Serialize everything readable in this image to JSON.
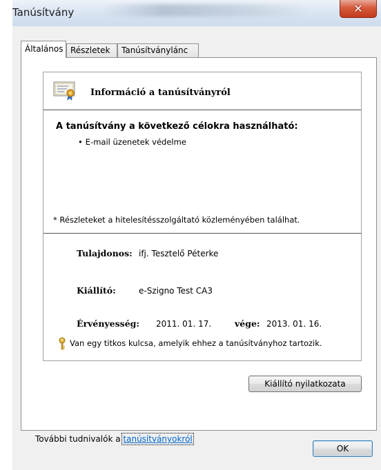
{
  "window": {
    "title": "Tanúsítvány",
    "close_glyph": "✕"
  },
  "tabs": [
    {
      "label": "Általános",
      "active": true
    },
    {
      "label": "Részletek",
      "active": false
    },
    {
      "label": "Tanúsítványlánc",
      "active": false
    }
  ],
  "general": {
    "info_title": "Információ a tanúsítványról",
    "purpose_heading": "A tanúsítvány a következő célokra használható:",
    "purposes": [
      "E-mail üzenetek védelme"
    ],
    "issuer_note": "* Részleteket a hitelesítésszolgáltató közleményében találhat.",
    "owner_label": "Tulajdonos:",
    "owner_value": "ifj. Tesztelő Péterke",
    "issuer_label": "Kiállító:",
    "issuer_value": "e-Szigno Test CA3",
    "validity_label": "Érvényesség:",
    "valid_from": "2011. 01. 17.",
    "valid_to_label": "vége:",
    "valid_to": "2013. 01. 16.",
    "private_key_note": "Van egy titkos kulcsa, amelyik ehhez a tanúsítványhoz tartozik."
  },
  "buttons": {
    "issuer_statement": "Kiállító nyilatkozata",
    "ok": "OK"
  },
  "footer": {
    "more_info_prefix": "További tudnivalók a ",
    "more_info_link": "tanúsítványokról"
  },
  "icons": {
    "certificate": "certificate-icon",
    "key": "key-icon",
    "close": "close-icon"
  },
  "colors": {
    "link": "#0066cc",
    "close_button": "#c9482a",
    "ribbon": "#e0a020"
  }
}
